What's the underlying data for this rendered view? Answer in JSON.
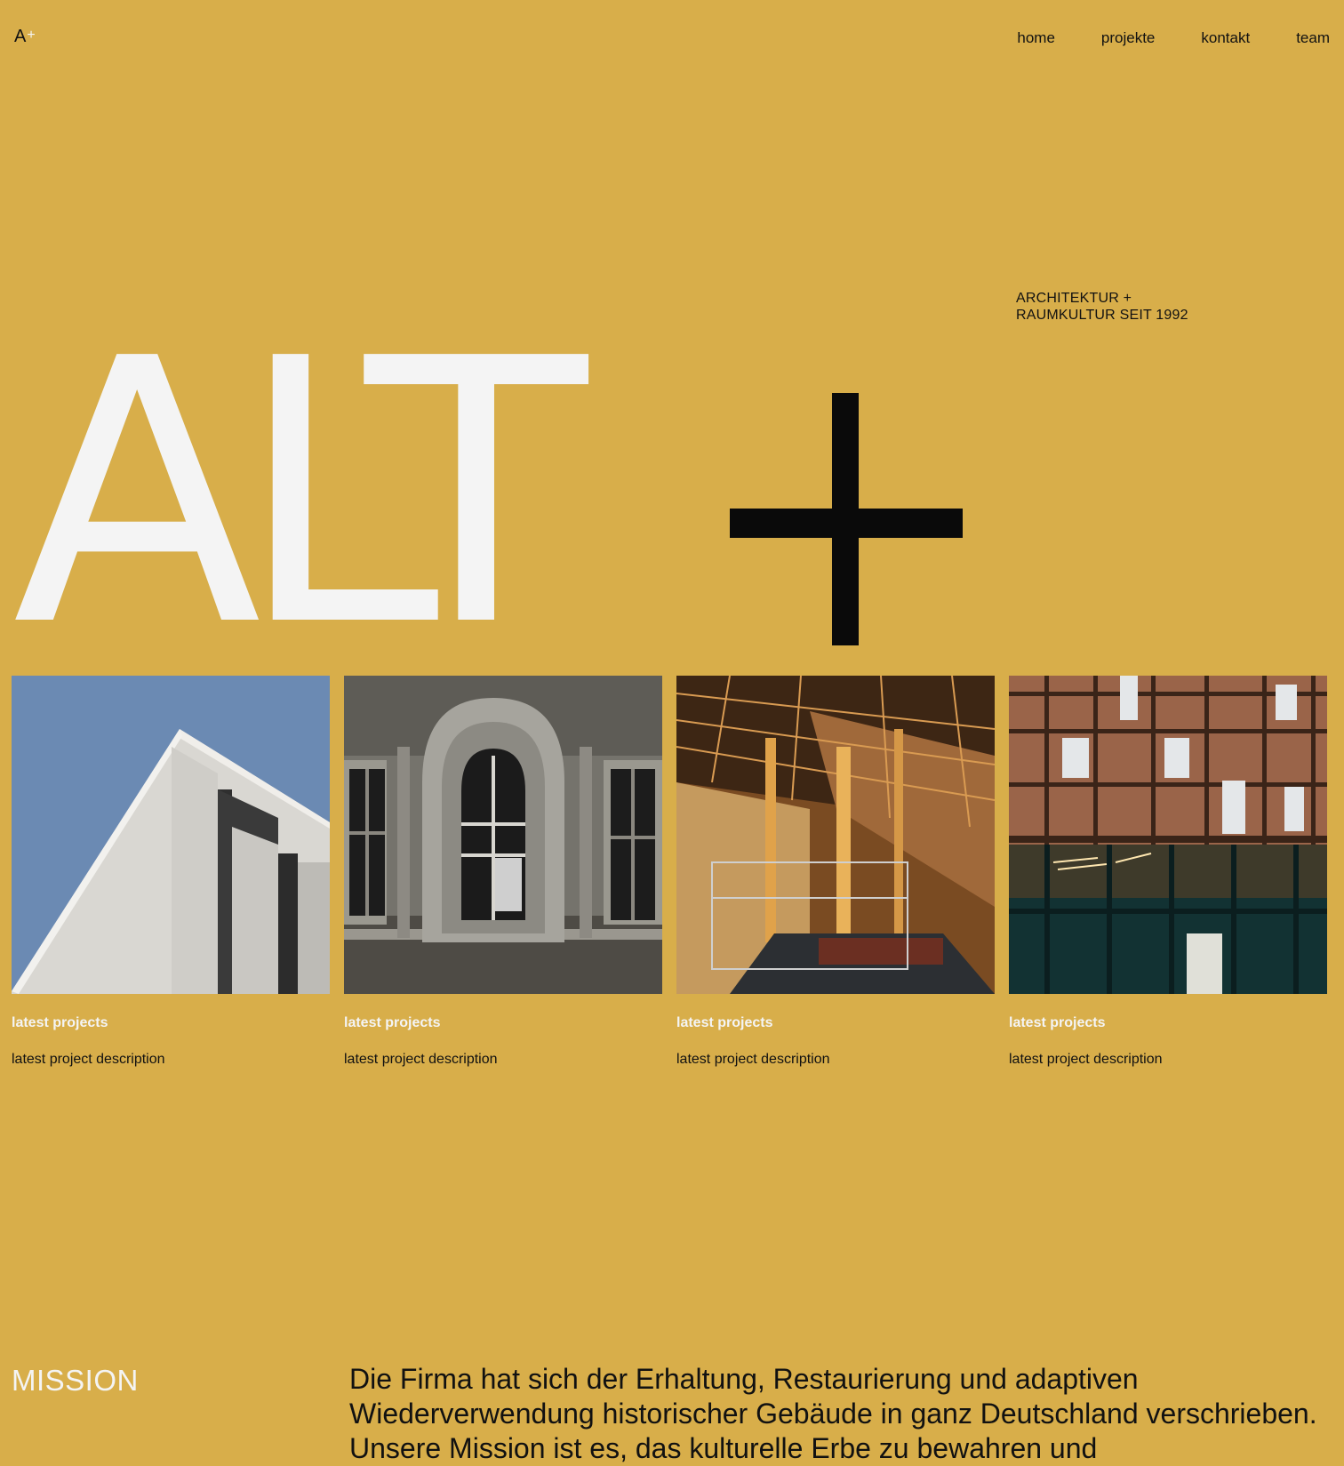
{
  "header": {
    "logo_letter": "A",
    "logo_plus": "+",
    "nav": [
      "home",
      "projekte",
      "kontakt",
      "team"
    ]
  },
  "tagline": {
    "line1": "ARCHITEKTUR +",
    "line2": "RAUMKULTUR SEIT 1992"
  },
  "hero": {
    "word": "ALT",
    "symbol": "plus-icon"
  },
  "projects": [
    {
      "title": "latest projects",
      "description": "latest project description",
      "image": "modern-white-building-photo"
    },
    {
      "title": "latest projects",
      "description": "latest project description",
      "image": "historic-facade-window-photo"
    },
    {
      "title": "latest projects",
      "description": "latest project description",
      "image": "industrial-hall-interior-photo"
    },
    {
      "title": "latest projects",
      "description": "latest project description",
      "image": "copper-facade-building-photo"
    }
  ],
  "mission": {
    "label": "MISSION",
    "text": "Die Firma hat sich der Erhaltung, Restaurierung und adaptiven Wiederverwendung historischer Gebäude in ganz Deutschland verschrieben. Unsere Mission ist es, das kulturelle Erbe zu bewahren und"
  },
  "colors": {
    "background": "#D8AE4A",
    "hero_letters": "#F4F4F4",
    "hero_plus": "#0A0A0A",
    "text": "#111111"
  }
}
